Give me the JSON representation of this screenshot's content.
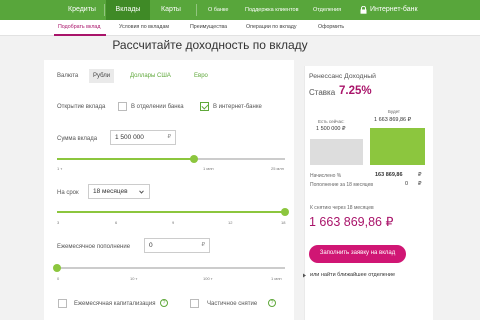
{
  "topnav": {
    "items": [
      {
        "label": "Кредиты"
      },
      {
        "label": "Вклады"
      },
      {
        "label": "Карты"
      },
      {
        "label": "О банке"
      },
      {
        "label": "Поддержка клиентов"
      },
      {
        "label": "Отделения"
      }
    ],
    "internet_bank": "Интернет-банк"
  },
  "subnav": {
    "items": [
      {
        "label": "Подобрать вклад"
      },
      {
        "label": "Условия по вкладам"
      },
      {
        "label": "Преимущества"
      },
      {
        "label": "Операции по вкладу"
      },
      {
        "label": "Оформить"
      }
    ]
  },
  "page_title": "Рассчитайте доходность по вкладу",
  "form": {
    "currency_label": "Валюта",
    "currencies": [
      "Рубли",
      "Доллары США",
      "Евро"
    ],
    "opening_label": "Открытие вклада",
    "opening_branch": "В отделении банка",
    "opening_online": "В интернет-банке",
    "amount_label": "Сумма вклада",
    "amount_value": "1 500 000",
    "amount_suffix": "₽",
    "amount_ticks": [
      "1 т",
      "1 млн",
      "25 млн"
    ],
    "amount_slider_level": 0.6,
    "term_label": "На срок",
    "term_value": "18 месяцев",
    "term_ticks": [
      "3",
      "6",
      "9",
      "12",
      "18"
    ],
    "term_slider_level": 1.0,
    "monthly_label": "Ежемесячное пополнение",
    "monthly_value": "0",
    "monthly_suffix": "₽",
    "monthly_ticks": [
      "0",
      "10 т",
      "100 т",
      "1 млн"
    ],
    "monthly_slider_level": 0.0,
    "capitalization_label": "Ежемесячная капитализация",
    "partial_withdrawal_label": "Частичное снятие",
    "info_mark": "?"
  },
  "result": {
    "deposit_name": "Ренессанс Доходный",
    "rate_label": "Ставка",
    "rate_value": "7.25%",
    "now_label": "Есть сейчас:",
    "now_value": "1 500 000 ₽",
    "will_label": "Будет",
    "will_value": "1 663 869,86 ₽",
    "interest_label": "Начислено %",
    "interest_value": "163 869,86",
    "topup_label": "Пополнение за 18 месяцев",
    "topup_value": "0",
    "currency_sign": "₽",
    "total_label": "К снятию через 18 месяцев",
    "total_value": "1 663 869,86 ₽",
    "apply_button": "Заполнить заявку на вклад",
    "branch_link": "или найти ближайшее отделение"
  }
}
